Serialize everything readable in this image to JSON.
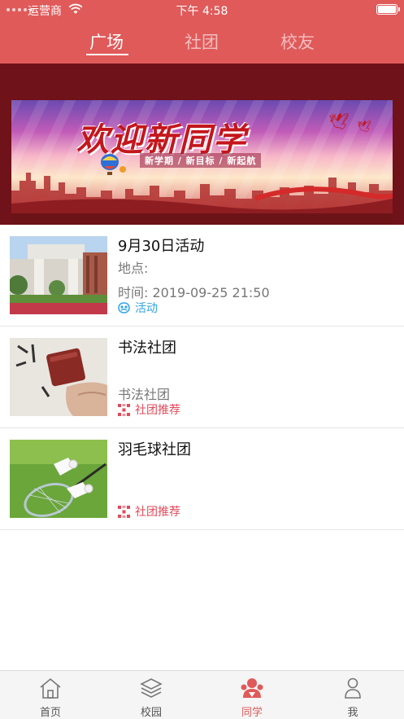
{
  "status_bar": {
    "carrier": "运营商",
    "time": "下午 4:58"
  },
  "top_tabs": [
    {
      "label": "广场",
      "active": true
    },
    {
      "label": "社团",
      "active": false
    },
    {
      "label": "校友",
      "active": false
    }
  ],
  "banner": {
    "title": "欢迎新同学",
    "subtitle": "新学期 / 新目标 / 新起航"
  },
  "feed": [
    {
      "title": "9月30日活动",
      "line1": "地点:",
      "line2": "时间:  2019-09-25 21:50",
      "tag": "活动",
      "tag_color": "#2fa3e6",
      "tag_icon": "activity-icon"
    },
    {
      "title": "书法社团",
      "line1": "",
      "line2": "书法社团",
      "tag": "社团推荐",
      "tag_color": "#e24a5a",
      "tag_icon": "club-recommend-icon"
    },
    {
      "title": "羽毛球社团",
      "line1": "",
      "line2": "",
      "tag": "社团推荐",
      "tag_color": "#e24a5a",
      "tag_icon": "club-recommend-icon"
    }
  ],
  "tab_bar": [
    {
      "label": "首页",
      "icon": "home-icon",
      "active": false
    },
    {
      "label": "校园",
      "icon": "layers-icon",
      "active": false
    },
    {
      "label": "同学",
      "icon": "classmates-icon",
      "active": true
    },
    {
      "label": "我",
      "icon": "person-icon",
      "active": false
    }
  ],
  "colors": {
    "primary": "#e05a5a",
    "hero_bg": "#70121a",
    "tag_blue": "#2fa3e6",
    "tag_red": "#e24a5a"
  }
}
